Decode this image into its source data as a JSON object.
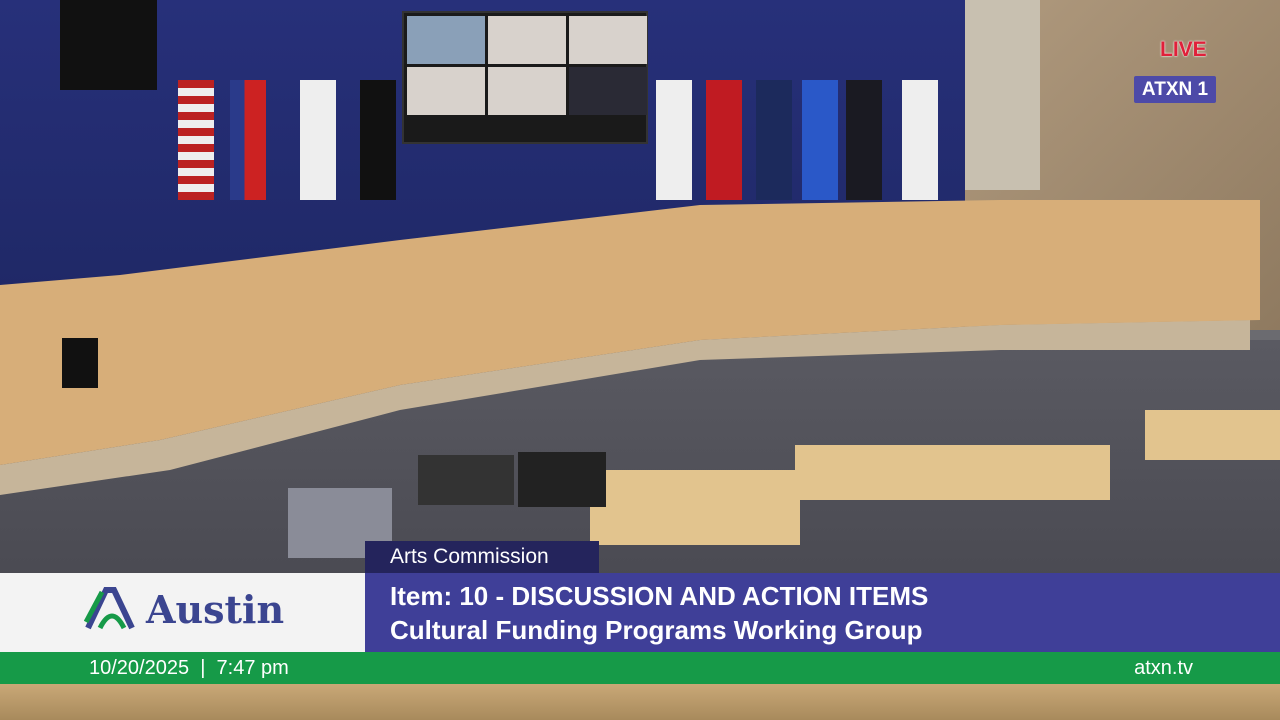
{
  "broadcast": {
    "live_label": "LIVE",
    "channel": "ATXN 1"
  },
  "lower_third": {
    "body_name": "Arts Commission",
    "logo_text": "Austin",
    "item_line": "Item: 10 - DISCUSSION AND ACTION ITEMS",
    "topic_line": "Cultural Funding Programs Working Group",
    "datetime": "10/20/2025  |  7:47 pm",
    "website": "atxn.tv"
  },
  "colors": {
    "purple": "#3f3f98",
    "navy": "#24245c",
    "green": "#169a48",
    "live_red": "#e0203a"
  }
}
